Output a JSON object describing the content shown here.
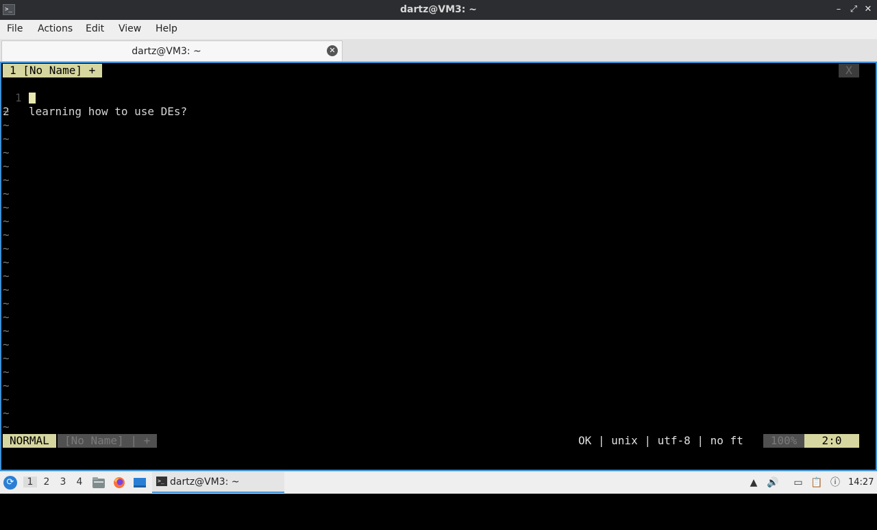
{
  "window": {
    "title": "dartz@VM3: ~",
    "icon_text": ">_",
    "minimize_glyph": "–",
    "restore_glyph": "⤢",
    "close_glyph": "✕"
  },
  "menubar": {
    "file": "File",
    "actions": "Actions",
    "edit": "Edit",
    "view": "View",
    "help": "Help"
  },
  "tab": {
    "label": "dartz@VM3: ~",
    "close_glyph": "✕"
  },
  "vim": {
    "tabline": {
      "tab_label": "1 [No Name] +",
      "close_label": "X"
    },
    "lines": [
      {
        "number": "1",
        "text": "learning how to use DEs?"
      },
      {
        "number": "2",
        "text": ""
      }
    ],
    "tilde": "~",
    "statusline": {
      "mode": "NORMAL",
      "file": "[No Name] | +",
      "info": "OK | unix | utf-8 | no ft",
      "percent": "100%",
      "position": "2:0"
    }
  },
  "taskbar": {
    "workspaces": [
      "1",
      "2",
      "3",
      "4"
    ],
    "active_workspace": "1",
    "task_label": "dartz@VM3: ~",
    "clock": "14:27"
  },
  "colors": {
    "terminal_border": "#3d8fd6",
    "vim_highlight": "#d6d6a0",
    "vim_inactive": "#505050"
  }
}
